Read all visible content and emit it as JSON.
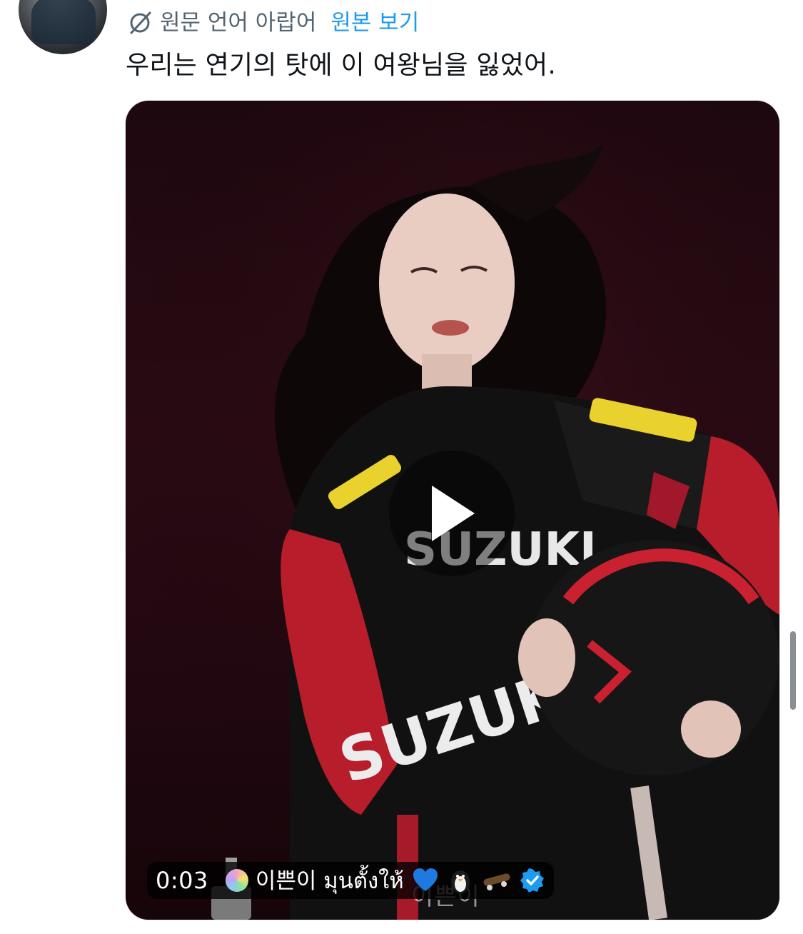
{
  "translation": {
    "label": "원문 언어 아랍어",
    "view_original": "원본 보기"
  },
  "tweet": {
    "text": "우리는 연기의 탓에 이 여왕님을 잃었어."
  },
  "video": {
    "caption": "이쁜이",
    "timestamp": "0:03",
    "title": "이쁜이 มุนตั้งให้"
  },
  "colors": {
    "link": "#1d9bf0",
    "secondary_text": "#536471",
    "verified": "#1d9bf0"
  }
}
